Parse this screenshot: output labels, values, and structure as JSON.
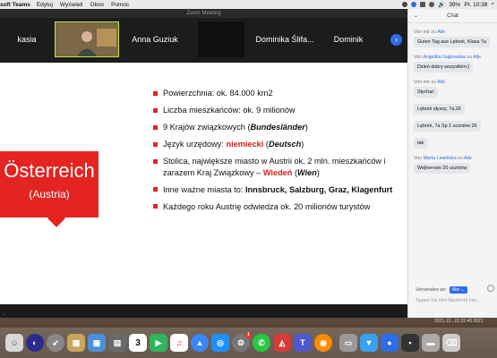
{
  "menubar": {
    "app_name": "soft Teams",
    "items": [
      "Edytuj",
      "Wyświetl",
      "Okno",
      "Pomoc"
    ],
    "battery": "39%",
    "clock": "Pt. 10:38"
  },
  "window": {
    "title": "Zoom Meeting"
  },
  "participants": [
    "kasia",
    "Anna Guziuk",
    "Dominika Ślifa...",
    "Dominik"
  ],
  "slide": {
    "country": "Österreich",
    "country_sub": "(Austria)",
    "b1": "Powierzchnia: ok. 84.000 km2",
    "b2": "Liczba mieszkańców: ok. 9 milionów",
    "b3_a": "9 Krajów związkowych (",
    "b3_b": "Bundesländer",
    "b3_c": ")",
    "b4_a": "Język urzędowy: ",
    "b4_b": "niemiecki",
    "b4_c": " (",
    "b4_d": "Deutsch",
    "b4_e": ")",
    "b5_a": "Stolica, największe miasto w Austrii ok. 2 mln. mieszkańców i zarazem Kraj Związkowy – ",
    "b5_b": "Wiedeń",
    "b5_c": " (",
    "b5_d": "Wien",
    "b5_e": ")",
    "b6_a": "Inne ważne miasta to: ",
    "b6_b": "Innsbruck, Salzburg, Graz, Klagenfurt",
    "b7": "Każdego roku Austrię odwiedza ok. 20 milionów turystów"
  },
  "chat": {
    "title": "Chat",
    "messages": [
      {
        "from_prefix": "Von mir zu ",
        "from_to": "Alle",
        "text": "Guten Tag aus Lębork, Klasa 7a"
      },
      {
        "from_prefix": "Von ",
        "from_name": "Angelika Gajkowska",
        "from_mid": " zu ",
        "from_to": "Alle",
        "text": "Dzień dobry wszystkim:)"
      },
      {
        "from_prefix": "Von mir zu ",
        "from_to": "Alle",
        "text": "Słychać"
      },
      {
        "text": "Lębork słyszy, 7a,26"
      },
      {
        "text": "Lębork, 7a Sp 1 uczniów 26"
      },
      {
        "text": "tak"
      },
      {
        "from_prefix": "Von ",
        "from_name": "Marta Lewińska",
        "from_mid": " zu ",
        "from_to": "Alle",
        "text": "Wejherowo 20 uczniów"
      }
    ],
    "send_to_label": "Versenden an:",
    "send_to_value": "Alle",
    "input_placeholder": "Tippen Sie Ihre Nachricht hier..."
  },
  "timestamp": "2021-12...22.32.40",
  "timestamp_right": "2021",
  "dock_calendar_day": "3",
  "dock_badge_count": "1",
  "colors": {
    "accent_red": "#e32420",
    "zoom_blue": "#2d6ee8"
  }
}
